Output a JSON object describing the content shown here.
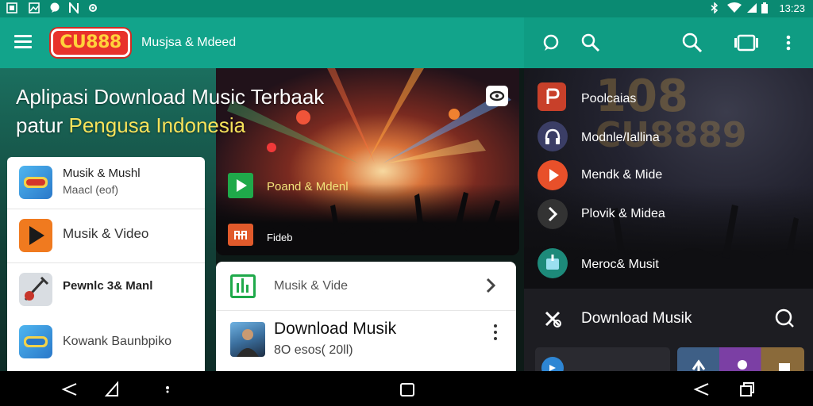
{
  "status_bar": {
    "left_icons": [
      "gallery-icon",
      "image-icon",
      "chat-icon",
      "n-icon",
      "gear-icon"
    ],
    "right_icons": [
      "bluetooth-icon",
      "wifi-icon",
      "signal-icon",
      "battery-icon"
    ],
    "time": "13:23"
  },
  "app_bar": {
    "logo_text": "CU888",
    "title": "Musjsa & Mdeed",
    "right_icons": [
      "chat-bubble-icon",
      "search-alt-icon",
      "search-icon",
      "cast-icon",
      "more-vert-icon"
    ]
  },
  "hero": {
    "title_line1": "Aplipasi Download Music Terbaak",
    "title_line2_prefix": "patur ",
    "title_line2_highlight": "Pengusa Indonesia"
  },
  "concert": {
    "row1_label": "Poand & Mdenl",
    "row2_label": "Fideb"
  },
  "left_list": {
    "items": [
      {
        "title": "Musik & Mushl",
        "subtitle": "Maacl (eof)",
        "icon": "app-logo-icon"
      },
      {
        "title": "Musik & Video",
        "subtitle": "",
        "icon": "play-icon"
      },
      {
        "title": "Pewnlc 3& Manl",
        "subtitle": "",
        "icon": "guitar-icon"
      },
      {
        "title": "Kowank Baunbpiko",
        "subtitle": "",
        "icon": "app-logo-icon"
      }
    ]
  },
  "mid_card": {
    "row_label": "Musik & Vide",
    "download_title": "Download Musik",
    "download_subtitle": "8O esos( 20ll)"
  },
  "right_panel": {
    "watermark1": "108",
    "watermark2": "CU8889",
    "items": [
      {
        "label": "Poolcaias",
        "icon": "podcast-icon",
        "color": "#c8402a"
      },
      {
        "label": "Modnle/Iallina",
        "icon": "headset-icon",
        "color": "#3b3e66"
      },
      {
        "label": "Mendk & Mide",
        "icon": "play-circle-icon",
        "color": "#e8502a"
      },
      {
        "label": "Plovik & Midea",
        "icon": "chevron-right-icon",
        "color": "#333"
      },
      {
        "label": "Meroc& Musit",
        "icon": "music-app-icon",
        "color": "#1d8a7a"
      }
    ],
    "download_row_title": "Download Musik"
  },
  "colors": {
    "accent": "#12a48b",
    "status_bar": "#0a8a72",
    "highlight_text": "#f6e25a",
    "logo_red": "#e8322b",
    "logo_yellow": "#ffd23b"
  },
  "nav_bar": {
    "icons": [
      "back-icon",
      "home-triangle-icon",
      "dot-icon",
      "square-icon",
      "back-icon",
      "recents-icon"
    ]
  }
}
